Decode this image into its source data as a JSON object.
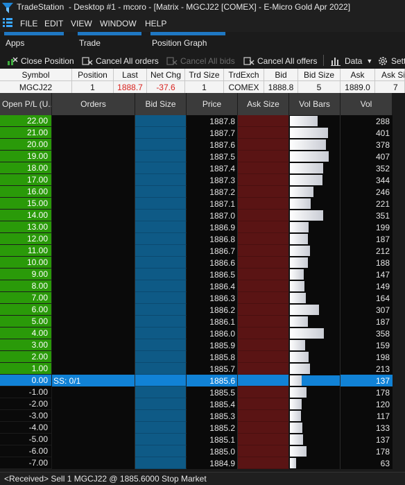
{
  "window": {
    "app_name": "TradeStation",
    "title": "- Desktop #1 - mcoro - [Matrix - MGCJ22 [COMEX] - E-Micro Gold Apr 2022]"
  },
  "menu": [
    "FILE",
    "EDIT",
    "VIEW",
    "WINDOW",
    "HELP"
  ],
  "tabs": [
    "Apps",
    "Trade",
    "Position Graph"
  ],
  "toolbar": {
    "close_position": "Close Position",
    "cancel_all_orders": "Cancel All orders",
    "cancel_all_bids": "Cancel All bids",
    "cancel_all_offers": "Cancel All offers",
    "data": "Data",
    "settings": "Setti"
  },
  "quote": {
    "headers": [
      "Symbol",
      "Position",
      "Last",
      "Net Chg",
      "Trd Size",
      "TrdExch",
      "Bid",
      "Bid Size",
      "Ask",
      "Ask Si"
    ],
    "values": [
      "MGCJ22",
      "1",
      "1888.7",
      "-37.6",
      "1",
      "COMEX",
      "1888.8",
      "5",
      "1889.0",
      "7"
    ]
  },
  "grid_headers": [
    "Open P/L (U...",
    "Orders",
    "Bid Size",
    "Price",
    "Ask Size",
    "Vol Bars",
    "Vol"
  ],
  "colors": {
    "profit_green": "#2a9a09",
    "bid_blue": "#0e5a86",
    "ask_red": "#5a1414",
    "current_row": "#1182d6",
    "negative_red": "#d8231f"
  },
  "ladder": [
    {
      "pl": "22.00",
      "orders": "",
      "price": "1887.8",
      "vol": "288"
    },
    {
      "pl": "21.00",
      "orders": "",
      "price": "1887.7",
      "vol": "401"
    },
    {
      "pl": "20.00",
      "orders": "",
      "price": "1887.6",
      "vol": "378"
    },
    {
      "pl": "19.00",
      "orders": "",
      "price": "1887.5",
      "vol": "407"
    },
    {
      "pl": "18.00",
      "orders": "",
      "price": "1887.4",
      "vol": "352"
    },
    {
      "pl": "17.00",
      "orders": "",
      "price": "1887.3",
      "vol": "344"
    },
    {
      "pl": "16.00",
      "orders": "",
      "price": "1887.2",
      "vol": "246"
    },
    {
      "pl": "15.00",
      "orders": "",
      "price": "1887.1",
      "vol": "221"
    },
    {
      "pl": "14.00",
      "orders": "",
      "price": "1887.0",
      "vol": "351"
    },
    {
      "pl": "13.00",
      "orders": "",
      "price": "1886.9",
      "vol": "199"
    },
    {
      "pl": "12.00",
      "orders": "",
      "price": "1886.8",
      "vol": "187"
    },
    {
      "pl": "11.00",
      "orders": "",
      "price": "1886.7",
      "vol": "212"
    },
    {
      "pl": "10.00",
      "orders": "",
      "price": "1886.6",
      "vol": "188"
    },
    {
      "pl": "9.00",
      "orders": "",
      "price": "1886.5",
      "vol": "147"
    },
    {
      "pl": "8.00",
      "orders": "",
      "price": "1886.4",
      "vol": "149"
    },
    {
      "pl": "7.00",
      "orders": "",
      "price": "1886.3",
      "vol": "164"
    },
    {
      "pl": "6.00",
      "orders": "",
      "price": "1886.2",
      "vol": "307"
    },
    {
      "pl": "5.00",
      "orders": "",
      "price": "1886.1",
      "vol": "187"
    },
    {
      "pl": "4.00",
      "orders": "",
      "price": "1886.0",
      "vol": "358"
    },
    {
      "pl": "3.00",
      "orders": "",
      "price": "1885.9",
      "vol": "159"
    },
    {
      "pl": "2.00",
      "orders": "",
      "price": "1885.8",
      "vol": "198"
    },
    {
      "pl": "1.00",
      "orders": "",
      "price": "1885.7",
      "vol": "213"
    },
    {
      "pl": "0.00",
      "orders": "SS: 0/1",
      "price": "1885.6",
      "vol": "137",
      "current": true
    },
    {
      "pl": "-1.00",
      "orders": "",
      "price": "1885.5",
      "vol": "178"
    },
    {
      "pl": "-2.00",
      "orders": "",
      "price": "1885.4",
      "vol": "120"
    },
    {
      "pl": "-3.00",
      "orders": "",
      "price": "1885.3",
      "vol": "117"
    },
    {
      "pl": "-4.00",
      "orders": "",
      "price": "1885.2",
      "vol": "133"
    },
    {
      "pl": "-5.00",
      "orders": "",
      "price": "1885.1",
      "vol": "137"
    },
    {
      "pl": "-6.00",
      "orders": "",
      "price": "1885.0",
      "vol": "178"
    },
    {
      "pl": "-7.00",
      "orders": "",
      "price": "1884.9",
      "vol": "63"
    }
  ],
  "status": "<Received> Sell 1 MGCJ22 @ 1885.6000 Stop Market"
}
